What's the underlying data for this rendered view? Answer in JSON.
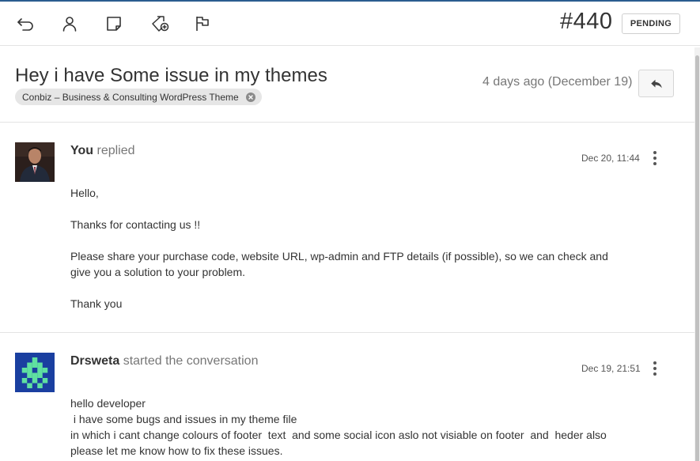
{
  "toolbar": {
    "icons": [
      "back-icon",
      "user-icon",
      "note-icon",
      "tag-add-icon",
      "flag-icon"
    ],
    "ticket_number": "#440",
    "status": "PENDING"
  },
  "header": {
    "subject": "Hey i have Some issue in my themes",
    "tag": "Conbiz – Business & Consulting WordPress Theme",
    "age": "4 days ago (December 19)"
  },
  "threads": [
    {
      "author": "You",
      "action": "replied",
      "timestamp": "Dec 20, 11:44",
      "lines": [
        "Hello,",
        "",
        "Thanks for contacting us !!",
        "",
        "Please share your purchase code, website URL, wp-admin and FTP details (if possible), so we can check and",
        "give you a solution to your problem.",
        "",
        "Thank you"
      ]
    },
    {
      "author": "Drsweta",
      "action": "started the conversation",
      "timestamp": "Dec 19, 21:51",
      "lines": [
        "hello  developer",
        " i have some bugs and issues in my theme file",
        "in which i cant change colours of footer  text  and some social icon aslo not visiable on footer  and  heder also",
        "please let me know how to fix these issues."
      ]
    }
  ],
  "colors": {
    "accent_line": "#2a5d8f",
    "identicon_bg": "#1a3fa0",
    "identicon_fg": "#5fe0a0"
  }
}
